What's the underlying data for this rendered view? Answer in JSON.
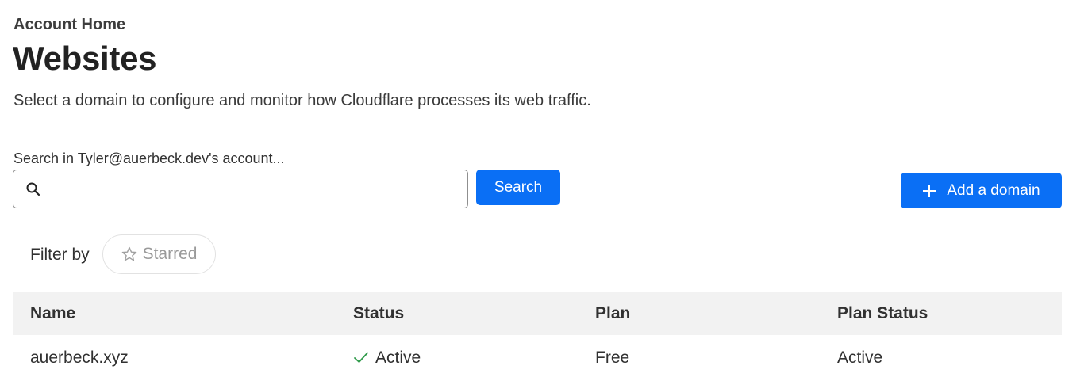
{
  "header": {
    "breadcrumb": "Account Home",
    "title": "Websites",
    "description": "Select a domain to configure and monitor how Cloudflare processes its web traffic."
  },
  "search": {
    "label": "Search in Tyler@auerbeck.dev's account...",
    "value": "",
    "placeholder": "",
    "button_label": "Search",
    "icon": "search-icon"
  },
  "actions": {
    "add_domain_label": "Add a domain",
    "add_icon": "plus-icon"
  },
  "filter": {
    "label": "Filter by",
    "chips": [
      {
        "label": "Starred",
        "icon": "star-outline-icon"
      }
    ]
  },
  "table": {
    "columns": [
      "Name",
      "Status",
      "Plan",
      "Plan Status"
    ],
    "rows": [
      {
        "name": "auerbeck.xyz",
        "status": "Active",
        "status_icon": "check-icon",
        "plan": "Free",
        "plan_status": "Active"
      }
    ]
  },
  "colors": {
    "primary": "#0a6ff5",
    "success": "#2f9a4a",
    "table_header_bg": "#f2f2f2",
    "text": "#313131"
  }
}
